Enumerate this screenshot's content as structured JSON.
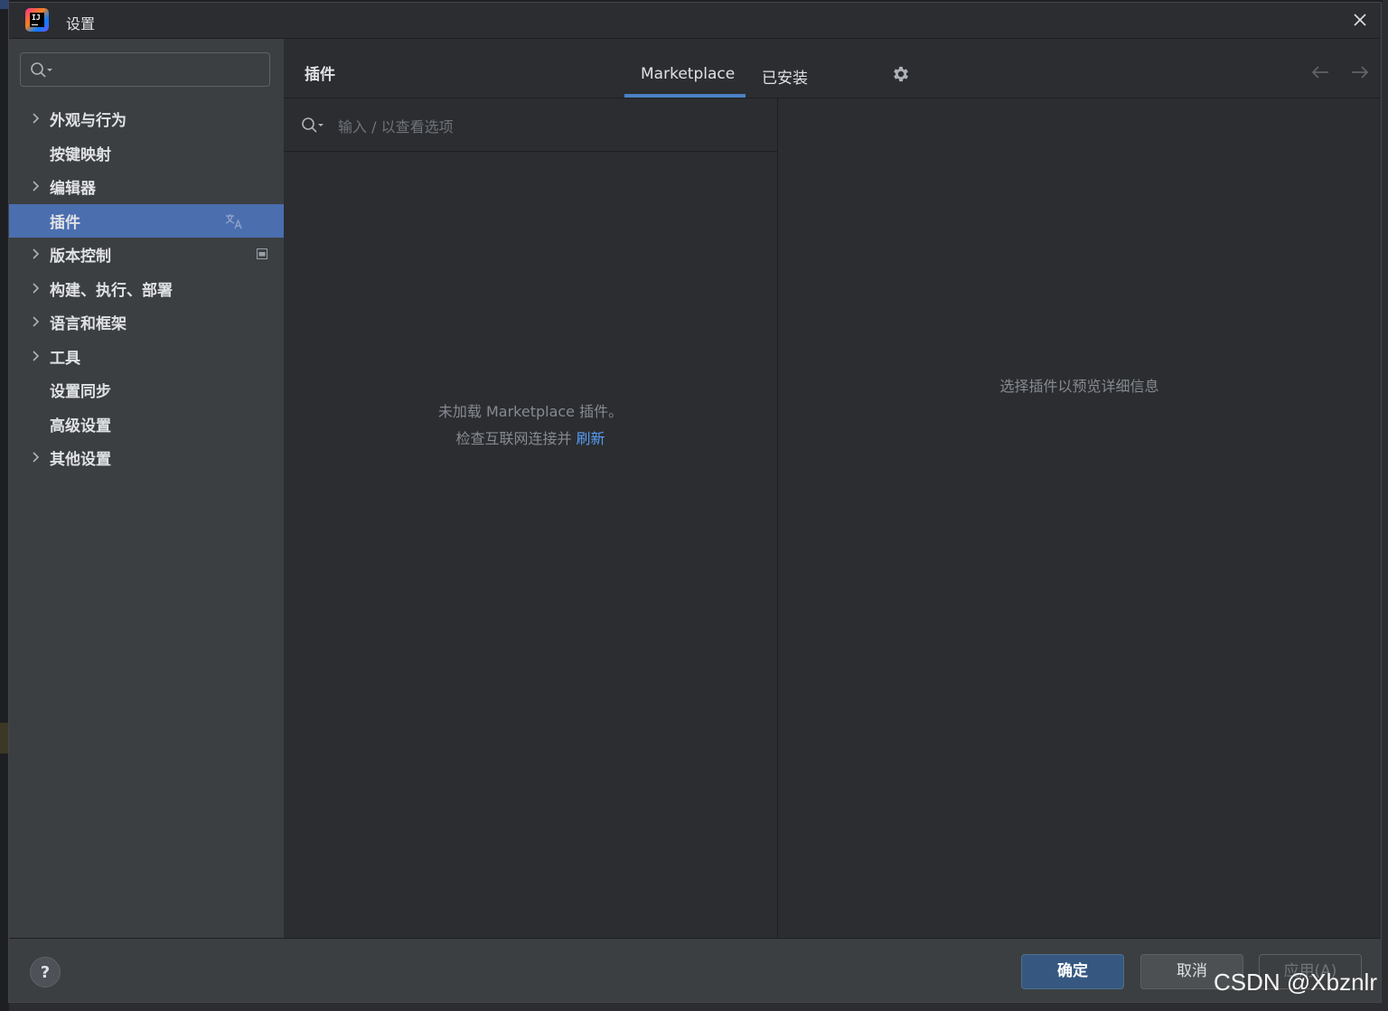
{
  "window": {
    "title": "设置"
  },
  "sidebar": {
    "search_value": "",
    "items": [
      {
        "label": "外观与行为",
        "expandable": true,
        "selected": false
      },
      {
        "label": "按键映射",
        "expandable": false,
        "selected": false
      },
      {
        "label": "编辑器",
        "expandable": true,
        "selected": false
      },
      {
        "label": "插件",
        "expandable": false,
        "selected": true,
        "trailing_icon": "translate-icon"
      },
      {
        "label": "版本控制",
        "expandable": true,
        "selected": false,
        "trailing_icon": "project-level-icon"
      },
      {
        "label": "构建、执行、部署",
        "expandable": true,
        "selected": false
      },
      {
        "label": "语言和框架",
        "expandable": true,
        "selected": false
      },
      {
        "label": "工具",
        "expandable": true,
        "selected": false
      },
      {
        "label": "设置同步",
        "expandable": false,
        "selected": false
      },
      {
        "label": "高级设置",
        "expandable": false,
        "selected": false
      },
      {
        "label": "其他设置",
        "expandable": true,
        "selected": false
      }
    ]
  },
  "main": {
    "title": "插件",
    "tabs": [
      {
        "label": "Marketplace",
        "active": true
      },
      {
        "label": "已安装",
        "active": false
      }
    ],
    "search_placeholder": "输入 / 以查看选项",
    "empty_message": "未加载 Marketplace 插件。",
    "empty_hint_prefix": "检查互联网连接并 ",
    "refresh_label": "刷新",
    "preview_hint": "选择插件以预览详细信息"
  },
  "footer": {
    "help_label": "?",
    "ok_label": "确定",
    "cancel_label": "取消",
    "apply_label": "应用(A)"
  },
  "watermark": "CSDN @Xbznlr",
  "colors": {
    "selection": "#4b6eaf",
    "accent_underline": "#4b82c4",
    "link": "#589df6",
    "primary_button": "#365880"
  }
}
